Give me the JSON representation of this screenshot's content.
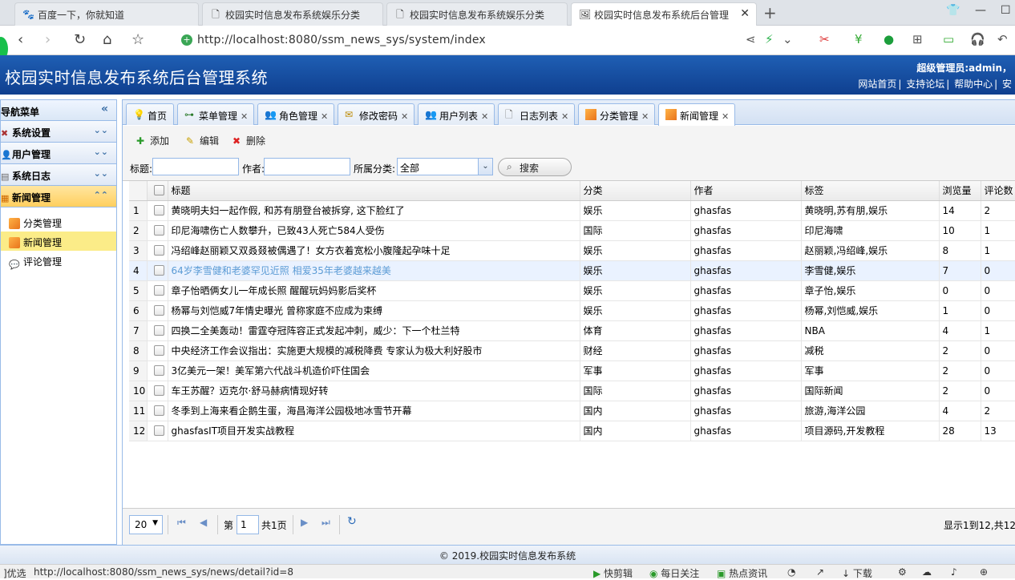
{
  "browser": {
    "tabs": [
      {
        "label": "百度一下，你就知道",
        "icon": "baidu-icon"
      },
      {
        "label": "校园实时信息发布系统娱乐分类",
        "icon": "page-icon"
      },
      {
        "label": "校园实时信息发布系统娱乐分类",
        "icon": "page-icon"
      },
      {
        "label": "校园实时信息发布系统后台管理",
        "icon": "page-icon"
      }
    ],
    "url": "http://localhost:8080/ssm_news_sys/system/index"
  },
  "header": {
    "title": "校园实时信息发布系统后台管理系统",
    "user": "超级管理员:admin，",
    "links": [
      "网站首页",
      "支持论坛",
      "帮助中心",
      "安"
    ]
  },
  "sidebar": {
    "title": "导航菜单",
    "panels": [
      {
        "label": "系统设置",
        "icon": "tools-icon"
      },
      {
        "label": "用户管理",
        "icon": "user-icon"
      },
      {
        "label": "系统日志",
        "icon": "log-icon"
      },
      {
        "label": "新闻管理",
        "icon": "news-icon"
      }
    ],
    "items": [
      {
        "label": "分类管理",
        "icon": "rss-icon"
      },
      {
        "label": "新闻管理",
        "icon": "rss-icon"
      },
      {
        "label": "评论管理",
        "icon": "comment-icon"
      }
    ]
  },
  "tabs": [
    {
      "label": "首页",
      "icon": "bulb-icon"
    },
    {
      "label": "菜单管理",
      "icon": "tree-icon"
    },
    {
      "label": "角色管理",
      "icon": "role-icon"
    },
    {
      "label": "修改密码",
      "icon": "key-icon"
    },
    {
      "label": "用户列表",
      "icon": "users-icon"
    },
    {
      "label": "日志列表",
      "icon": "doc-icon"
    },
    {
      "label": "分类管理",
      "icon": "rss-icon"
    },
    {
      "label": "新闻管理",
      "icon": "rss-icon"
    }
  ],
  "toolbar": {
    "add": "添加",
    "edit": "编辑",
    "delete": "删除",
    "title_label": "标题:",
    "author_label": "作者:",
    "category_label": "所属分类:",
    "category_value": "全部",
    "search": "搜索"
  },
  "grid": {
    "columns": [
      "标题",
      "分类",
      "作者",
      "标签",
      "浏览量",
      "评论数"
    ],
    "rows": [
      {
        "n": "1",
        "title": "黄晓明夫妇一起作假, 和苏有朋登台被拆穿, 这下脸红了",
        "cat": "娱乐",
        "author": "ghasfas",
        "tags": "黄晓明,苏有朋,娱乐",
        "views": "14",
        "comments": "2"
      },
      {
        "n": "2",
        "title": "印尼海啸伤亡人数攀升，已致43人死亡584人受伤",
        "cat": "国际",
        "author": "ghasfas",
        "tags": "印尼海啸",
        "views": "10",
        "comments": "1"
      },
      {
        "n": "3",
        "title": "冯绍峰赵丽颖又双叒叕被偶遇了！女方衣着宽松小腹隆起孕味十足",
        "cat": "娱乐",
        "author": "ghasfas",
        "tags": "赵丽颖,冯绍峰,娱乐",
        "views": "8",
        "comments": "1"
      },
      {
        "n": "4",
        "title": "64岁李雪健和老婆罕见近照 相爱35年老婆越来越美",
        "cat": "娱乐",
        "author": "ghasfas",
        "tags": "李雪健,娱乐",
        "views": "7",
        "comments": "0"
      },
      {
        "n": "5",
        "title": "章子怡晒俩女儿一年成长照 醒醒玩妈妈影后奖杯",
        "cat": "娱乐",
        "author": "ghasfas",
        "tags": "章子怡,娱乐",
        "views": "0",
        "comments": "0"
      },
      {
        "n": "6",
        "title": "杨幂与刘恺威7年情史曝光 曾称家庭不应成为束缚",
        "cat": "娱乐",
        "author": "ghasfas",
        "tags": "杨幂,刘恺威,娱乐",
        "views": "1",
        "comments": "0"
      },
      {
        "n": "7",
        "title": "四换二全美轰动！雷霆夺冠阵容正式发起冲刺，威少：下一个杜兰特",
        "cat": "体育",
        "author": "ghasfas",
        "tags": "NBA",
        "views": "4",
        "comments": "1"
      },
      {
        "n": "8",
        "title": "中央经济工作会议指出：实施更大规模的减税降费 专家认为极大利好股市",
        "cat": "财经",
        "author": "ghasfas",
        "tags": "减税",
        "views": "2",
        "comments": "0"
      },
      {
        "n": "9",
        "title": "3亿美元一架！美军第六代战斗机造价吓住国会",
        "cat": "军事",
        "author": "ghasfas",
        "tags": "军事",
        "views": "2",
        "comments": "0"
      },
      {
        "n": "10",
        "title": "车王苏醒？迈克尔·舒马赫病情现好转",
        "cat": "国际",
        "author": "ghasfas",
        "tags": "国际新闻",
        "views": "2",
        "comments": "0"
      },
      {
        "n": "11",
        "title": "冬季到上海来看企鹅生蛋，海昌海洋公园极地冰雪节开幕",
        "cat": "国内",
        "author": "ghasfas",
        "tags": "旅游,海洋公园",
        "views": "4",
        "comments": "2"
      },
      {
        "n": "12",
        "title": "ghasfasIT项目开发实战教程",
        "cat": "国内",
        "author": "ghasfas",
        "tags": "项目源码,开发教程",
        "views": "28",
        "comments": "13"
      }
    ]
  },
  "pager": {
    "page_size": "20",
    "page_prefix": "第",
    "page": "1",
    "page_suffix": "共1页",
    "summary": "显示1到12,共12"
  },
  "footer": "© 2019.校园实时信息发布系统",
  "status": {
    "left": "]优选",
    "url": "http://localhost:8080/ssm_news_sys/news/detail?id=8",
    "items": [
      "快剪辑",
      "每日关注",
      "热点资讯",
      "下载"
    ]
  }
}
